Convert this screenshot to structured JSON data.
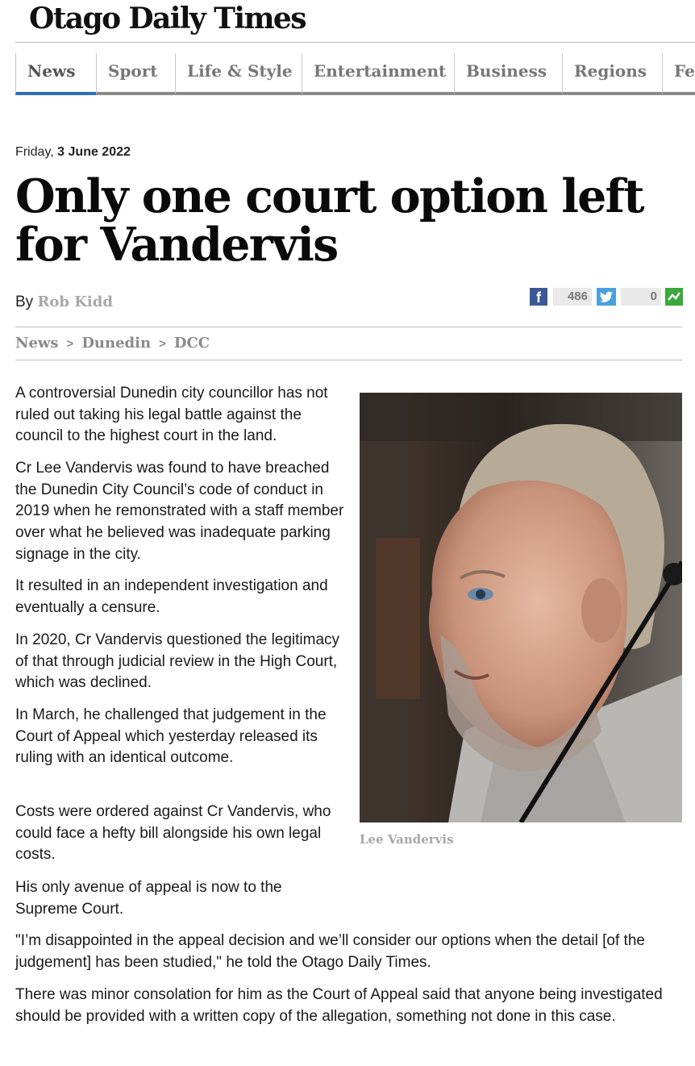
{
  "site": {
    "title": "Otago Daily Times"
  },
  "nav": {
    "tabs": [
      {
        "label": "News",
        "active": true
      },
      {
        "label": "Sport"
      },
      {
        "label": "Life & Style"
      },
      {
        "label": "Entertainment"
      },
      {
        "label": "Business"
      },
      {
        "label": "Regions"
      },
      {
        "label": "Fea"
      }
    ]
  },
  "article": {
    "date_day": "Friday,",
    "date_full": "3 June 2022",
    "headline": "Only one court option left for Vandervis",
    "by_label": "By",
    "author": "Rob Kidd",
    "share": {
      "facebook_count": "486",
      "twitter_count": "0",
      "facebook_icon": "facebook-icon",
      "twitter_icon": "twitter-icon",
      "share_icon": "share-icon",
      "colors": {
        "facebook": "#3b5998",
        "twitter": "#4aa2dc",
        "share": "#3aa83a"
      }
    },
    "breadcrumb": [
      "News",
      "Dunedin",
      "DCC"
    ],
    "paragraphs": [
      "A controversial Dunedin city councillor has not ruled out taking his legal battle against the council to the highest court in the land.",
      "Cr Lee Vandervis was found to have breached the Dunedin City Council’s code of conduct in 2019 when he remonstrated with a staff member over what he believed was inadequate parking signage in the city.",
      "It resulted in an independent investigation and eventually a censure.",
      "In 2020, Cr Vandervis questioned the legitimacy of that through judicial review in the High Court, which was declined.",
      "In March, he challenged that judgement in the Court of Appeal which yesterday released its ruling with an identical outcome.",
      "Costs were ordered against Cr Vandervis, who could face a hefty bill alongside his own legal costs.",
      "His only avenue of appeal is now to the Supreme Court.",
      "\"I’m disappointed in the appeal decision and we’ll consider our options when the detail [of the judgement] has been studied,\" he told the Otago Daily Times.",
      "There was minor consolation for him as the Court of Appeal said that anyone being investigated should be provided with a written copy of the allegation, something not done in this case."
    ],
    "photo_caption": "Lee Vandervis",
    "accent_color": "#2a6fb7"
  }
}
